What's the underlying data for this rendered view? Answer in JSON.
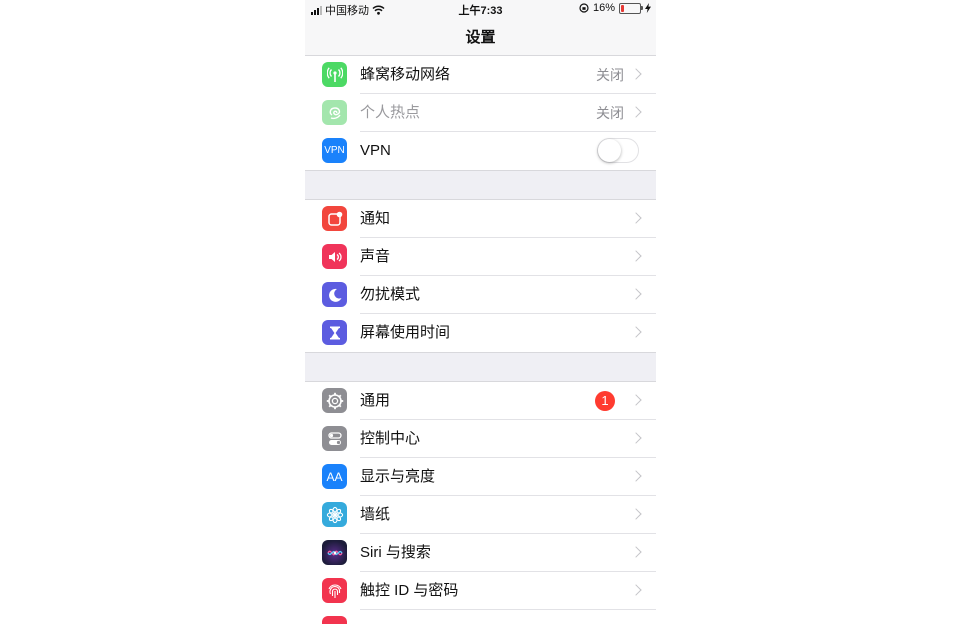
{
  "status_bar": {
    "carrier": "中国移动",
    "time": "上午7:33",
    "battery_percent": "16%",
    "battery_level": 0.16,
    "battery_color": "#e53935"
  },
  "nav": {
    "title": "设置"
  },
  "section1": [
    {
      "label": "蜂窝移动网络",
      "value": "关闭",
      "icon": "antenna-icon",
      "color": "#4cd964"
    },
    {
      "label": "个人热点",
      "value": "关闭",
      "icon": "hotspot-icon",
      "color": "#a3e6ad",
      "dimmed": true
    },
    {
      "label": "VPN",
      "icon_text": "VPN",
      "icon": "vpn-icon",
      "color": "#1a82fb",
      "toggle": false
    }
  ],
  "section2": [
    {
      "label": "通知",
      "icon": "notifications-icon",
      "color": "#f2463d"
    },
    {
      "label": "声音",
      "icon": "speaker-icon",
      "color": "#f0345a"
    },
    {
      "label": "勿扰模式",
      "icon": "moon-icon",
      "color": "#5c5ce0"
    },
    {
      "label": "屏幕使用时间",
      "icon": "hourglass-icon",
      "color": "#5c5ce0"
    }
  ],
  "section3": [
    {
      "label": "通用",
      "icon": "gear-icon",
      "color": "#8e8e93",
      "badge": "1"
    },
    {
      "label": "控制中心",
      "icon": "toggles-icon",
      "color": "#8e8e93"
    },
    {
      "label": "显示与亮度",
      "icon_text": "AA",
      "icon": "display-icon",
      "color": "#1a82fb"
    },
    {
      "label": "墙纸",
      "icon": "flower-icon",
      "color": "#35aadc"
    },
    {
      "label": "Siri 与搜索",
      "icon": "siri-icon",
      "color": "#1c1c3a"
    },
    {
      "label": "触控 ID 与密码",
      "icon": "fingerprint-icon",
      "color": "#f2344e"
    }
  ]
}
